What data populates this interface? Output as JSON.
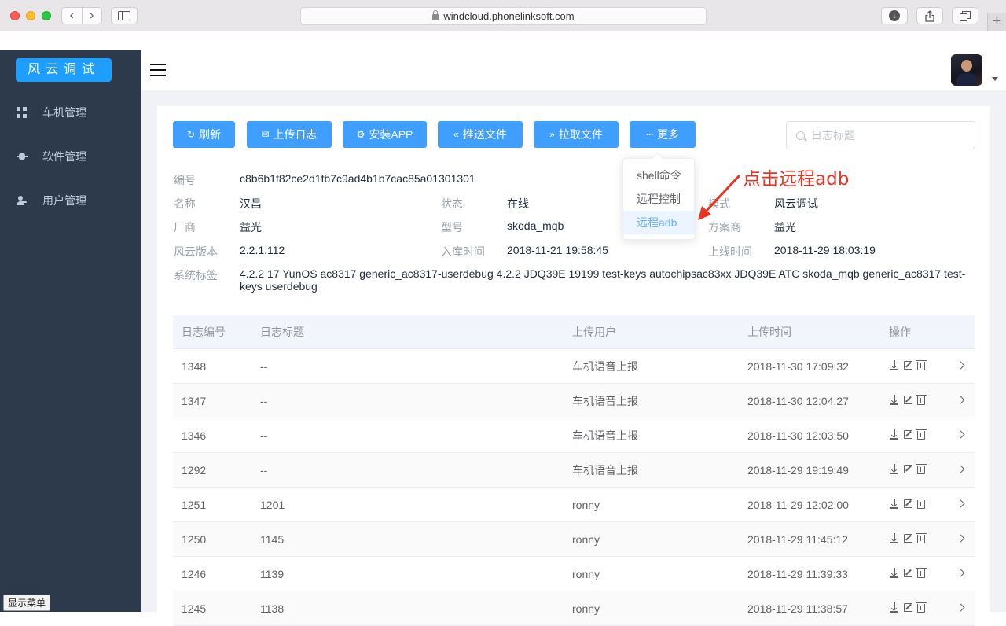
{
  "browser": {
    "url": "windcloud.phonelinksoft.com",
    "back": "‹",
    "forward": "›",
    "new_tab": "+"
  },
  "sidebar": {
    "brand": "风云调试",
    "items": [
      {
        "label": "车机管理",
        "icon": "dashboard-grid-icon"
      },
      {
        "label": "软件管理",
        "icon": "bug-icon"
      },
      {
        "label": "用户管理",
        "icon": "users-icon"
      }
    ],
    "show_menu": "显示菜单"
  },
  "toolbar": {
    "buttons": [
      {
        "label": "刷新",
        "icon": "refresh-icon",
        "glyph": "↻"
      },
      {
        "label": "上传日志",
        "icon": "mail-icon",
        "glyph": "✉"
      },
      {
        "label": "安装APP",
        "icon": "settings-icon",
        "glyph": "⚙"
      },
      {
        "label": "推送文件",
        "icon": "double-left-icon",
        "glyph": "«"
      },
      {
        "label": "拉取文件",
        "icon": "double-right-icon",
        "glyph": "»"
      },
      {
        "label": "更多",
        "icon": "more-icon",
        "glyph": "···"
      }
    ],
    "search_placeholder": "日志标题"
  },
  "dropdown": {
    "items": [
      "shell命令",
      "远程控制",
      "远程adb"
    ],
    "active": "远程adb"
  },
  "annotation": "点击远程adb",
  "device": {
    "id_label": "编号",
    "id": "c8b6b1f82ce2d1fb7c9ad4b1b7cac85a01301301",
    "name_label": "名称",
    "name": "汉昌",
    "status_label": "状态",
    "status": "在线",
    "mode_label": "模式",
    "mode": "风云调试",
    "vendor_label": "厂商",
    "vendor": "益光",
    "model_label": "型号",
    "model": "skoda_mqb",
    "solution_label": "方案商",
    "solution": "益光",
    "version_label": "风云版本",
    "version": "2.2.1.112",
    "stock_time_label": "入库时间",
    "stock_time": "2018-11-21 19:58:45",
    "online_time_label": "上线时间",
    "online_time": "2018-11-29 18:03:19",
    "tags_label": "系统标签",
    "tags": "4.2.2 17 YunOS ac8317 generic_ac8317-userdebug 4.2.2 JDQ39E 19199 test-keys autochipsac83xx JDQ39E ATC skoda_mqb generic_ac8317 test-keys userdebug"
  },
  "table": {
    "headers": [
      "日志编号",
      "日志标题",
      "上传用户",
      "上传时间",
      "操作"
    ],
    "rows": [
      {
        "id": "1348",
        "title": "--",
        "user": "车机语音上报",
        "time": "2018-11-30 17:09:32"
      },
      {
        "id": "1347",
        "title": "--",
        "user": "车机语音上报",
        "time": "2018-11-30 12:04:27"
      },
      {
        "id": "1346",
        "title": "--",
        "user": "车机语音上报",
        "time": "2018-11-30 12:03:50"
      },
      {
        "id": "1292",
        "title": "--",
        "user": "车机语音上报",
        "time": "2018-11-29 19:19:49"
      },
      {
        "id": "1251",
        "title": "1201",
        "user": "ronny",
        "time": "2018-11-29 12:02:00"
      },
      {
        "id": "1250",
        "title": "1145",
        "user": "ronny",
        "time": "2018-11-29 11:45:12"
      },
      {
        "id": "1246",
        "title": "1139",
        "user": "ronny",
        "time": "2018-11-29 11:39:33"
      },
      {
        "id": "1245",
        "title": "1138",
        "user": "ronny",
        "time": "2018-11-29 11:38:57"
      }
    ]
  }
}
